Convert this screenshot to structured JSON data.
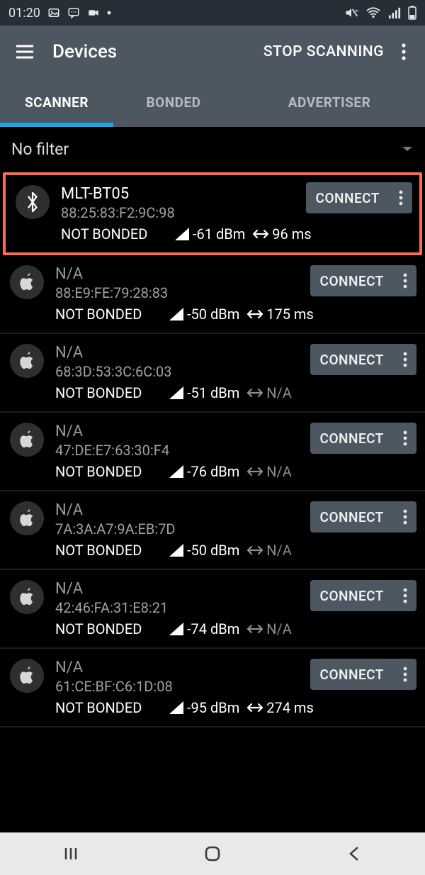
{
  "statusbar": {
    "time": "01:20"
  },
  "appbar": {
    "title": "Devices",
    "action": "STOP SCANNING"
  },
  "tabs": [
    {
      "label": "SCANNER",
      "active": true
    },
    {
      "label": "BONDED",
      "active": false
    },
    {
      "label": "ADVERTISER",
      "active": false
    }
  ],
  "filter": {
    "label": "No filter"
  },
  "connect_label": "CONNECT",
  "devices": [
    {
      "name": "MLT-BT05",
      "name_dim": false,
      "mac": "88:25:83:F2:9C:98",
      "bond": "NOT BONDED",
      "rssi": "-61 dBm",
      "interval": "96 ms",
      "interval_na": false,
      "icon": "bluetooth",
      "highlight": true
    },
    {
      "name": "N/A",
      "name_dim": true,
      "mac": "88:E9:FE:79:28:83",
      "bond": "NOT BONDED",
      "rssi": "-50 dBm",
      "interval": "175 ms",
      "interval_na": false,
      "icon": "apple",
      "highlight": false
    },
    {
      "name": "N/A",
      "name_dim": true,
      "mac": "68:3D:53:3C:6C:03",
      "bond": "NOT BONDED",
      "rssi": "-51 dBm",
      "interval": "N/A",
      "interval_na": true,
      "icon": "apple",
      "highlight": false
    },
    {
      "name": "N/A",
      "name_dim": true,
      "mac": "47:DE:E7:63:30:F4",
      "bond": "NOT BONDED",
      "rssi": "-76 dBm",
      "interval": "N/A",
      "interval_na": true,
      "icon": "apple",
      "highlight": false
    },
    {
      "name": "N/A",
      "name_dim": true,
      "mac": "7A:3A:A7:9A:EB:7D",
      "bond": "NOT BONDED",
      "rssi": "-50 dBm",
      "interval": "N/A",
      "interval_na": true,
      "icon": "apple",
      "highlight": false
    },
    {
      "name": "N/A",
      "name_dim": true,
      "mac": "42:46:FA:31:E8:21",
      "bond": "NOT BONDED",
      "rssi": "-74 dBm",
      "interval": "N/A",
      "interval_na": true,
      "icon": "apple",
      "highlight": false
    },
    {
      "name": "N/A",
      "name_dim": true,
      "mac": "61:CE:BF:C6:1D:08",
      "bond": "NOT BONDED",
      "rssi": "-95 dBm",
      "interval": "274 ms",
      "interval_na": false,
      "icon": "apple",
      "highlight": false
    }
  ]
}
